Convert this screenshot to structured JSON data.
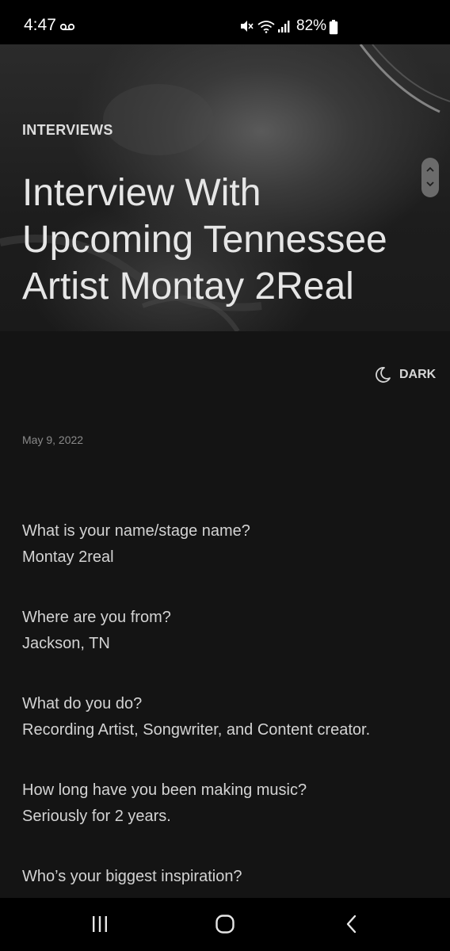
{
  "status_bar": {
    "time": "4:47",
    "battery": "82%",
    "icons": [
      "voicemail-icon",
      "mute-icon",
      "wifi-icon",
      "signal-icon",
      "battery-icon"
    ]
  },
  "hero": {
    "category": "INTERVIEWS",
    "title": "Interview With Upcoming Tennessee Artist Montay 2Real"
  },
  "theme_toggle": {
    "label": "DARK",
    "icon": "moon-icon"
  },
  "post": {
    "date": "May 9, 2022",
    "qa": [
      {
        "question": "What is your name/stage name?",
        "answer": "Montay 2real"
      },
      {
        "question": "Where are you from?",
        "answer": "Jackson, TN"
      },
      {
        "question": "What do you do?",
        "answer": "Recording Artist, Songwriter, and Content creator."
      },
      {
        "question": "How long have you been making music?",
        "answer": "Seriously for 2 years."
      },
      {
        "question": "Who’s your biggest inspiration?",
        "answer": ""
      }
    ]
  },
  "nav_bar": {
    "icons": [
      "recent-apps-icon",
      "home-icon",
      "back-icon"
    ]
  },
  "colors": {
    "background": "#141414",
    "text": "#d3d3d3",
    "muted": "#8a8a8a",
    "bars": "#000000"
  }
}
